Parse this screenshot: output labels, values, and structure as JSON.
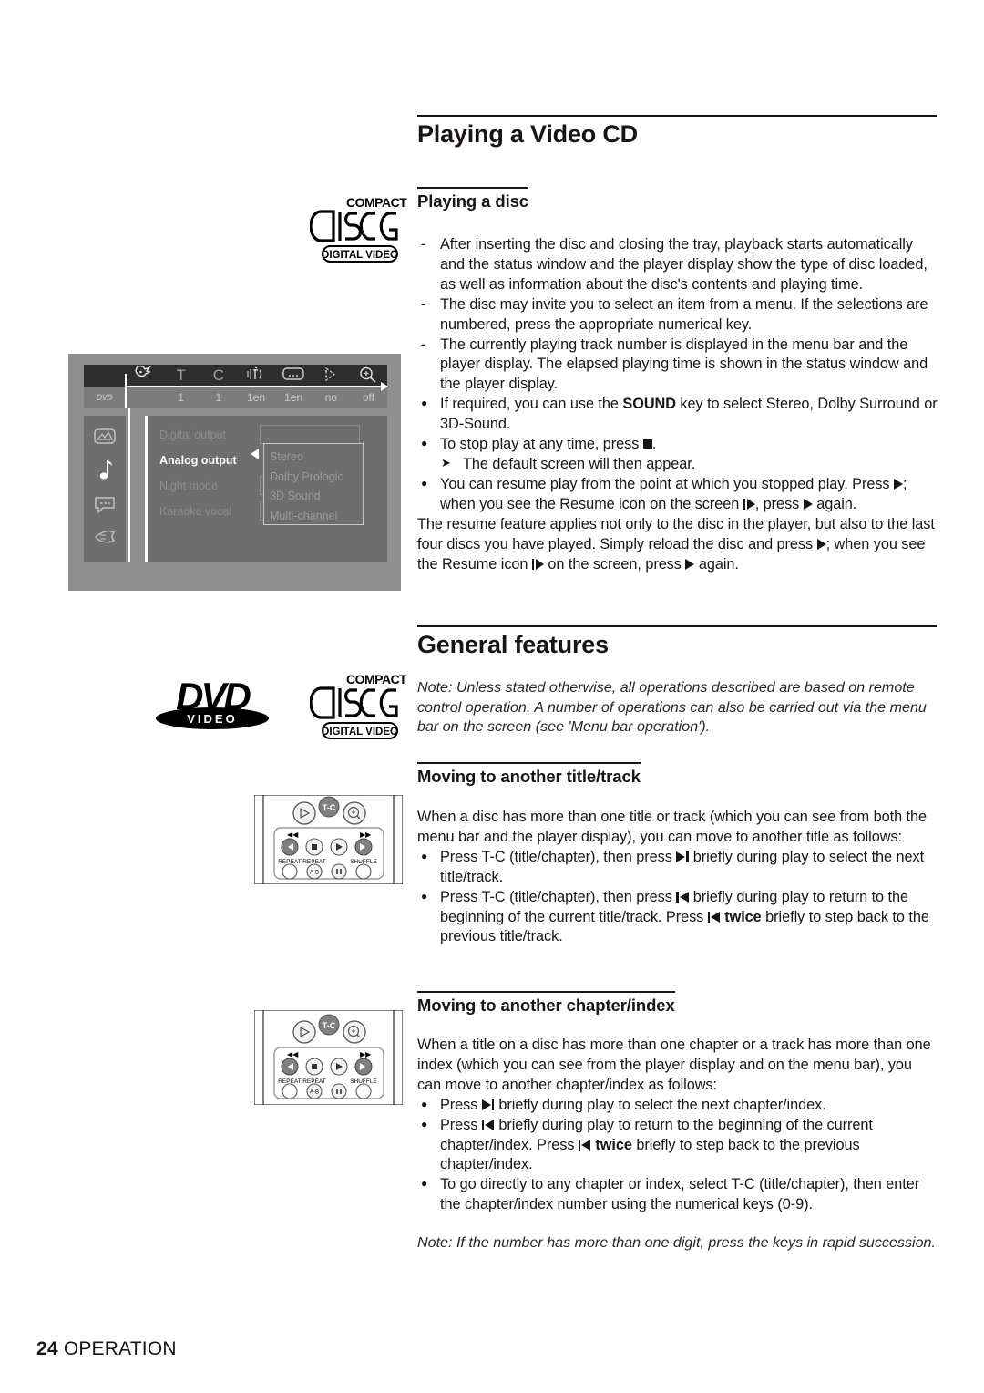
{
  "page": {
    "footer_page_number": "24",
    "footer_section": "OPERATION"
  },
  "sections": {
    "video_cd": {
      "title": "Playing a Video CD",
      "playing_disc": {
        "heading": "Playing a disc",
        "dash_items": [
          "After inserting the disc and closing the tray, playback starts automatically and the status window and the player display show the type of disc loaded, as well as information about the disc's contents and playing time.",
          "The disc may invite you to select an item from a menu. If the selections are numbered, press the appropriate numerical key.",
          "The currently playing track number is displayed in the menu bar and the player display. The elapsed playing time is shown in the status window and the player display."
        ],
        "bullet_sound_pre": "If required, you can use the ",
        "bullet_sound_key": "SOUND",
        "bullet_sound_post": " key to select Stereo, Dolby Surround or 3D-Sound.",
        "bullet_stop_pre": "To stop play at any time, press ",
        "bullet_stop_post": ".",
        "sub_default_screen": "The default screen will then appear.",
        "bullet_resume_a": "You can resume play from the point at which you stopped play. Press ",
        "bullet_resume_b": "; when you see the Resume icon on the screen ",
        "bullet_resume_c": ", press ",
        "bullet_resume_d": " again.",
        "resume_para_a": "The resume feature applies not only to the disc in the player, but also to the last four discs you have played. Simply reload the disc and press ",
        "resume_para_b": "; when you see the Resume icon ",
        "resume_para_c": " on the screen, press ",
        "resume_para_d": " again."
      }
    },
    "general_features": {
      "title": "General features",
      "note": "Note: Unless stated otherwise, all operations described are based on remote control operation. A number of operations can also be carried out via the menu bar on the screen (see 'Menu bar operation').",
      "title_track": {
        "heading": "Moving to another title/track",
        "intro": "When a disc has more than one title or track (which you can see from both the menu bar and the player display), you can move to another title as follows:",
        "b1_a": "Press T-C (title/chapter), then press ",
        "b1_b": " briefly during play to select the next title/track.",
        "b2_a": "Press T-C (title/chapter), then press ",
        "b2_b": " briefly during play to return to the beginning of the current title/track. Press ",
        "b2_c": " ",
        "b2_bold": "twice",
        "b2_d": " briefly to step back to the previous title/track."
      },
      "chapter_index": {
        "heading": "Moving to another chapter/index",
        "intro": "When a title on a disc has more than one chapter or a track has more than one index (which you can see from the player display and on the menu bar), you can move to another chapter/index as follows:",
        "b1_a": "Press ",
        "b1_b": " briefly during play to select the next chapter/index.",
        "b2_a": "Press ",
        "b2_b": " briefly during play to return to the beginning of the current chapter/index. Press ",
        "b2_bold": "twice",
        "b2_d": " briefly to step back to the previous chapter/index.",
        "b3": "To go directly to any chapter or index, select T-C (title/chapter), then enter the chapter/index number using the numerical keys (0-9).",
        "note": "Note: If the number has more than one digit, press the keys in rapid succession."
      }
    }
  },
  "logos": {
    "cd_compact": "COMPACT",
    "cd_word": "disc",
    "cd_digital_video": "DIGITAL VIDEO",
    "dvd_word": "DVD",
    "dvd_video": "VIDEO"
  },
  "osd": {
    "menubar_icons": [
      "dvd-disc-icon",
      "pointer-hand-icon",
      "title-t-icon",
      "chapter-c-icon",
      "audio-language-icon",
      "subtitle-icon",
      "camera-angle-icon",
      "zoom-magnifier-icon"
    ],
    "menubar_values": [
      "1",
      "1",
      "1en",
      "1en",
      "no",
      "off"
    ],
    "dvd_chip_label": "DVD",
    "sidebar_icons": [
      "picture-settings-icon",
      "audio-settings-icon",
      "subtitle-settings-icon",
      "features-hand-icon"
    ],
    "menu_items": [
      {
        "label": "Digital output",
        "active": false
      },
      {
        "label": "Analog output",
        "active": true
      },
      {
        "label": "Night mode",
        "active": false
      },
      {
        "label": "Karaoke vocal",
        "active": false
      }
    ],
    "submenu_items": [
      "Stereo",
      "Dolby Prologic",
      "3D Sound",
      "Multi-channel"
    ]
  },
  "remote": {
    "tc_button": "T-C",
    "rew_label": "◄◄",
    "ffwd_label": "►►",
    "row_labels": [
      "REPEAT",
      "REPEAT",
      "SHUFFLE"
    ],
    "ab_label": "A-B",
    "buttons": [
      "prev-track-button",
      "stop-button",
      "play-button",
      "next-track-button",
      "repeat-button",
      "repeat-ab-button",
      "pause-button",
      "shuffle-button"
    ]
  },
  "colors": {
    "ink": "#1a1416",
    "osd_menubar": "#2e2e2e",
    "osd_panel": "#6e6e6e",
    "osd_bg": "#8f8f8f"
  }
}
